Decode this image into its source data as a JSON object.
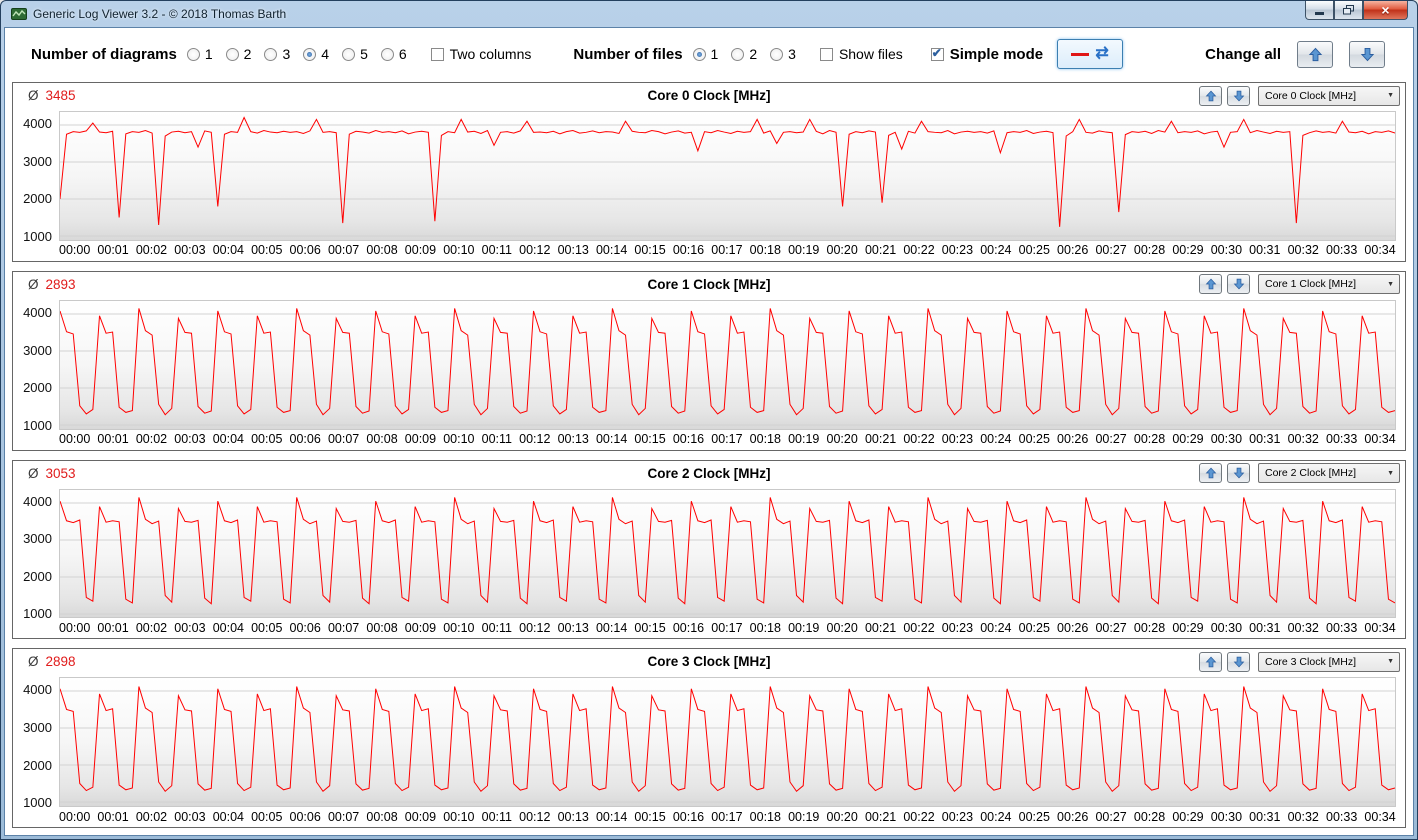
{
  "window": {
    "title": "Generic Log Viewer 3.2 - © 2018 Thomas Barth"
  },
  "icons": {
    "close": "×",
    "dropdown_arrow": "▼",
    "refresh": "⇄"
  },
  "toolbar": {
    "diagrams_label": "Number of diagrams",
    "diagram_options": [
      "1",
      "2",
      "3",
      "4",
      "5",
      "6"
    ],
    "diagrams_selected": "4",
    "two_columns_label": "Two columns",
    "two_columns_checked": false,
    "files_label": "Number of files",
    "file_options": [
      "1",
      "2",
      "3"
    ],
    "files_selected": "1",
    "show_files_label": "Show files",
    "show_files_checked": false,
    "simple_mode_label": "Simple mode",
    "simple_mode_checked": true,
    "change_all_label": "Change all"
  },
  "panels": [
    {
      "avg_symbol": "Ø",
      "avg": "3485",
      "title": "Core 0 Clock [MHz]",
      "dropdown": "Core 0 Clock [MHz]"
    },
    {
      "avg_symbol": "Ø",
      "avg": "2893",
      "title": "Core 1 Clock [MHz]",
      "dropdown": "Core 1 Clock [MHz]"
    },
    {
      "avg_symbol": "Ø",
      "avg": "3053",
      "title": "Core 2 Clock [MHz]",
      "dropdown": "Core 2 Clock [MHz]"
    },
    {
      "avg_symbol": "Ø",
      "avg": "2898",
      "title": "Core 3 Clock [MHz]",
      "dropdown": "Core 3 Clock [MHz]"
    }
  ],
  "axis": {
    "x_ticks": [
      "00:00",
      "00:01",
      "00:02",
      "00:03",
      "00:04",
      "00:05",
      "00:06",
      "00:07",
      "00:08",
      "00:09",
      "00:10",
      "00:11",
      "00:12",
      "00:13",
      "00:14",
      "00:15",
      "00:16",
      "00:17",
      "00:18",
      "00:19",
      "00:20",
      "00:21",
      "00:22",
      "00:23",
      "00:24",
      "00:25",
      "00:26",
      "00:27",
      "00:28",
      "00:29",
      "00:30",
      "00:31",
      "00:32",
      "00:33",
      "00:34"
    ]
  },
  "chart_data": [
    {
      "type": "line",
      "title": "Core 0 Clock [MHz]",
      "average": 3485,
      "color": "#ff0000",
      "ylim": [
        900,
        4350
      ],
      "y_gridlines": [
        1000,
        2000,
        3000,
        4000
      ],
      "x_range": [
        "00:00",
        "00:34"
      ],
      "grid": true,
      "legend": false,
      "values": [
        2000,
        3750,
        3820,
        3800,
        3840,
        4050,
        3810,
        3790,
        3830,
        1500,
        3760,
        3820,
        3800,
        3850,
        3780,
        1300,
        3700,
        3810,
        3830,
        3790,
        3820,
        3400,
        3840,
        3800,
        1800,
        3750,
        3820,
        3800,
        4200,
        3820,
        3780,
        3850,
        3810,
        3790,
        3830,
        3800,
        3820,
        3770,
        3840,
        4150,
        3800,
        3820,
        3790,
        1350,
        3750,
        3830,
        3810,
        3780,
        3850,
        3800,
        3820,
        3790,
        3840,
        3760,
        3810,
        3830,
        3800,
        1400,
        3720,
        3820,
        3790,
        4150,
        3810,
        3830,
        3770,
        3850,
        3450,
        3800,
        3820,
        3780,
        3840,
        4100,
        3800,
        3810,
        3790,
        3830,
        3760,
        3820,
        3850,
        3780,
        3800,
        3840,
        3790,
        3820,
        3810,
        3770,
        4100,
        3830,
        3800,
        3790,
        3850,
        3820,
        3760,
        3810,
        3840,
        3780,
        3800,
        3300,
        3820,
        3790,
        3850,
        3810,
        3770,
        3830,
        3800,
        3820,
        4150,
        3780,
        3840,
        3500,
        3800,
        3820,
        3790,
        3810,
        4150,
        3830,
        3760,
        3850,
        3800,
        1800,
        3750,
        3820,
        3790,
        3840,
        3810,
        1900,
        3720,
        3800,
        3350,
        3830,
        3780,
        4100,
        3820,
        3800,
        3790,
        3850,
        3760,
        3810,
        3830,
        3800,
        3820,
        3780,
        3840,
        3250,
        3790,
        3820,
        3800,
        3850,
        3770,
        3810,
        3830,
        3790,
        1250,
        3700,
        3820,
        4150,
        3800,
        3780,
        3840,
        3810,
        3790,
        1650,
        3740,
        3820,
        3800,
        3830,
        3770,
        3850,
        3810,
        4100,
        3790,
        3820,
        3800,
        3840,
        3760,
        3810,
        3830,
        3400,
        3800,
        3820,
        4150,
        3790,
        3850,
        3810,
        3770,
        3830,
        3800,
        3820,
        1350,
        3720,
        3790,
        3840,
        3800,
        3820,
        3780,
        4100,
        3810,
        3790,
        3830,
        3760,
        3820,
        3800,
        3840,
        3780
      ]
    },
    {
      "type": "line",
      "title": "Core 1 Clock [MHz]",
      "average": 2893,
      "color": "#ff0000",
      "ylim": [
        900,
        4350
      ],
      "y_gridlines": [
        1000,
        2000,
        3000,
        4000
      ],
      "x_range": [
        "00:00",
        "00:34"
      ],
      "grid": true,
      "legend": false,
      "values": [
        4080,
        3520,
        3460,
        1520,
        1300,
        1420,
        3950,
        3480,
        3510,
        1480,
        1340,
        1390,
        4150,
        3550,
        3430,
        1560,
        1280,
        1450,
        3880,
        3500,
        3480,
        1500,
        1320,
        1380,
        4080,
        3520,
        3460,
        1520,
        1300,
        1420,
        3950,
        3480,
        3510,
        1480,
        1340,
        1390,
        4150,
        3550,
        3430,
        1560,
        1280,
        1450,
        3880,
        3500,
        3480,
        1500,
        1320,
        1380,
        4080,
        3520,
        3460,
        1520,
        1300,
        1420,
        3950,
        3480,
        3510,
        1480,
        1340,
        1390,
        4150,
        3550,
        3430,
        1560,
        1280,
        1450,
        3880,
        3500,
        3480,
        1500,
        1320,
        1380,
        4080,
        3520,
        3460,
        1520,
        1300,
        1420,
        3950,
        3480,
        3510,
        1480,
        1340,
        1390,
        4150,
        3550,
        3430,
        1560,
        1280,
        1450,
        3880,
        3500,
        3480,
        1500,
        1320,
        1380,
        4080,
        3520,
        3460,
        1520,
        1300,
        1420,
        3950,
        3480,
        3510,
        1480,
        1340,
        1390,
        4150,
        3550,
        3430,
        1560,
        1280,
        1450,
        3880,
        3500,
        3480,
        1500,
        1320,
        1380,
        4080,
        3520,
        3460,
        1520,
        1300,
        1420,
        3950,
        3480,
        3510,
        1480,
        1340,
        1390,
        4150,
        3550,
        3430,
        1560,
        1280,
        1450,
        3880,
        3500,
        3480,
        1500,
        1320,
        1380,
        4080,
        3520,
        3460,
        1520,
        1300,
        1420,
        3950,
        3480,
        3510,
        1480,
        1340,
        1390,
        4150,
        3550,
        3430,
        1560,
        1280,
        1450,
        3880,
        3500,
        3480,
        1500,
        1320,
        1380,
        4080,
        3520,
        3460,
        1520,
        1300,
        1420,
        3950,
        3480,
        3510,
        1480,
        1340,
        1390,
        4150,
        3550,
        3430,
        1560,
        1280,
        1450,
        3880,
        3500,
        3480,
        1500,
        1320,
        1380,
        4080,
        3520,
        3460,
        1520,
        1300,
        1420,
        3950,
        3480,
        3510,
        1480,
        1340,
        1390
      ]
    },
    {
      "type": "line",
      "title": "Core 2 Clock [MHz]",
      "average": 3053,
      "color": "#ff0000",
      "ylim": [
        900,
        4350
      ],
      "y_gridlines": [
        1000,
        2000,
        3000,
        4000
      ],
      "x_range": [
        "00:00",
        "00:34"
      ],
      "grid": true,
      "legend": false,
      "values": [
        4050,
        3520,
        3470,
        3540,
        1450,
        1350,
        3900,
        3480,
        3520,
        3490,
        1400,
        1300,
        4150,
        3560,
        3440,
        3510,
        1500,
        1320,
        3850,
        3500,
        3480,
        3530,
        1430,
        1280,
        4050,
        3520,
        3470,
        3540,
        1450,
        1350,
        3900,
        3480,
        3520,
        3490,
        1400,
        1300,
        4150,
        3560,
        3440,
        3510,
        1500,
        1320,
        3850,
        3500,
        3480,
        3530,
        1430,
        1280,
        4050,
        3520,
        3470,
        3540,
        1450,
        1350,
        3900,
        3480,
        3520,
        3490,
        1400,
        1300,
        4150,
        3560,
        3440,
        3510,
        1500,
        1320,
        3850,
        3500,
        3480,
        3530,
        1430,
        1280,
        4050,
        3520,
        3470,
        3540,
        1450,
        1350,
        3900,
        3480,
        3520,
        3490,
        1400,
        1300,
        4150,
        3560,
        3440,
        3510,
        1500,
        1320,
        3850,
        3500,
        3480,
        3530,
        1430,
        1280,
        4050,
        3520,
        3470,
        3540,
        1450,
        1350,
        3900,
        3480,
        3520,
        3490,
        1400,
        1300,
        4150,
        3560,
        3440,
        3510,
        1500,
        1320,
        3850,
        3500,
        3480,
        3530,
        1430,
        1280,
        4050,
        3520,
        3470,
        3540,
        1450,
        1350,
        3900,
        3480,
        3520,
        3490,
        1400,
        1300,
        4150,
        3560,
        3440,
        3510,
        1500,
        1320,
        3850,
        3500,
        3480,
        3530,
        1430,
        1280,
        4050,
        3520,
        3470,
        3540,
        1450,
        1350,
        3900,
        3480,
        3520,
        3490,
        1400,
        1300,
        4150,
        3560,
        3440,
        3510,
        1500,
        1320,
        3850,
        3500,
        3480,
        3530,
        1430,
        1280,
        4050,
        3520,
        3470,
        3540,
        1450,
        1350,
        3900,
        3480,
        3520,
        3490,
        1400,
        1300,
        4150,
        3560,
        3440,
        3510,
        1500,
        1320,
        3850,
        3500,
        3480,
        3530,
        1430,
        1280,
        4050,
        3520,
        3470,
        3540,
        1450,
        1350,
        3900,
        3480,
        3520,
        3490,
        1400,
        1300
      ]
    },
    {
      "type": "line",
      "title": "Core 3 Clock [MHz]",
      "average": 2898,
      "color": "#ff0000",
      "ylim": [
        900,
        4350
      ],
      "y_gridlines": [
        1000,
        2000,
        3000,
        4000
      ],
      "x_range": [
        "00:00",
        "00:34"
      ],
      "grid": true,
      "legend": false,
      "values": [
        4060,
        3500,
        3450,
        1500,
        1310,
        1400,
        3920,
        3470,
        3520,
        1460,
        1330,
        1380,
        4120,
        3540,
        3420,
        1540,
        1290,
        1440,
        3870,
        3490,
        3460,
        1490,
        1320,
        1370,
        4060,
        3500,
        3450,
        1500,
        1310,
        1400,
        3920,
        3470,
        3520,
        1460,
        1330,
        1380,
        4120,
        3540,
        3420,
        1540,
        1290,
        1440,
        3870,
        3490,
        3460,
        1490,
        1320,
        1370,
        4060,
        3500,
        3450,
        1500,
        1310,
        1400,
        3920,
        3470,
        3520,
        1460,
        1330,
        1380,
        4120,
        3540,
        3420,
        1540,
        1290,
        1440,
        3870,
        3490,
        3460,
        1490,
        1320,
        1370,
        4060,
        3500,
        3450,
        1500,
        1310,
        1400,
        3920,
        3470,
        3520,
        1460,
        1330,
        1380,
        4120,
        3540,
        3420,
        1540,
        1290,
        1440,
        3870,
        3490,
        3460,
        1490,
        1320,
        1370,
        4060,
        3500,
        3450,
        1500,
        1310,
        1400,
        3920,
        3470,
        3520,
        1460,
        1330,
        1380,
        4120,
        3540,
        3420,
        1540,
        1290,
        1440,
        3870,
        3490,
        3460,
        1490,
        1320,
        1370,
        4060,
        3500,
        3450,
        1500,
        1310,
        1400,
        3920,
        3470,
        3520,
        1460,
        1330,
        1380,
        4120,
        3540,
        3420,
        1540,
        1290,
        1440,
        3870,
        3490,
        3460,
        1490,
        1320,
        1370,
        4060,
        3500,
        3450,
        1500,
        1310,
        1400,
        3920,
        3470,
        3520,
        1460,
        1330,
        1380,
        4120,
        3540,
        3420,
        1540,
        1290,
        1440,
        3870,
        3490,
        3460,
        1490,
        1320,
        1370,
        4060,
        3500,
        3450,
        1500,
        1310,
        1400,
        3920,
        3470,
        3520,
        1460,
        1330,
        1380,
        4120,
        3540,
        3420,
        1540,
        1290,
        1440,
        3870,
        3490,
        3460,
        1490,
        1320,
        1370,
        4060,
        3500,
        3450,
        1500,
        1310,
        1400,
        3920,
        3470,
        3520,
        1460,
        1330,
        1380
      ]
    }
  ],
  "colors": {
    "series_line": "#ff0000",
    "average_text": "#e01b1b",
    "accent_blue": "#5a96d2"
  }
}
